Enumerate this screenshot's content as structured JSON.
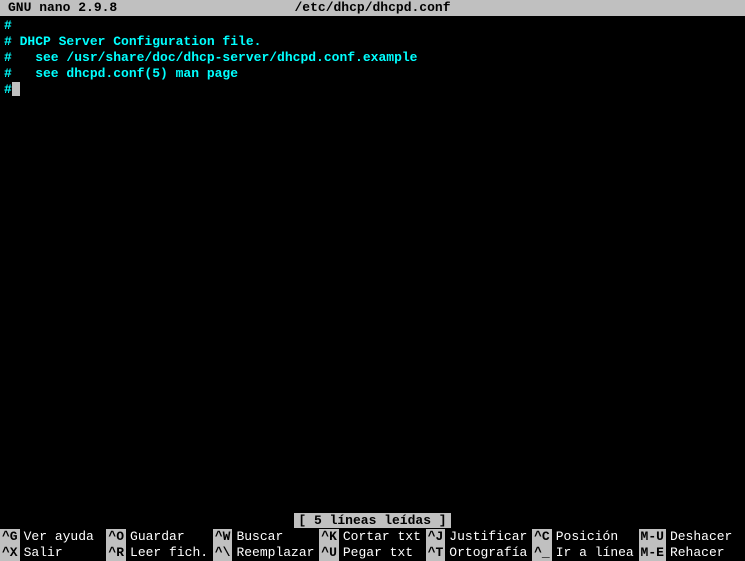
{
  "titlebar": {
    "app": "GNU nano 2.9.8",
    "filename": "/etc/dhcp/dhcpd.conf"
  },
  "content": {
    "lines": [
      "#",
      "# DHCP Server Configuration file.",
      "#   see /usr/share/doc/dhcp-server/dhcpd.conf.example",
      "#   see dhcpd.conf(5) man page",
      "#"
    ]
  },
  "status": {
    "message": "[ 5 líneas leídas ]"
  },
  "help": {
    "row1": [
      {
        "key": "^G",
        "label": "Ver ayuda"
      },
      {
        "key": "^O",
        "label": "Guardar"
      },
      {
        "key": "^W",
        "label": "Buscar"
      },
      {
        "key": "^K",
        "label": "Cortar txt"
      },
      {
        "key": "^J",
        "label": "Justificar"
      },
      {
        "key": "^C",
        "label": "Posición"
      },
      {
        "key": "M-U",
        "label": "Deshacer"
      }
    ],
    "row2": [
      {
        "key": "^X",
        "label": "Salir"
      },
      {
        "key": "^R",
        "label": "Leer fich."
      },
      {
        "key": "^\\",
        "label": "Reemplazar"
      },
      {
        "key": "^U",
        "label": "Pegar txt"
      },
      {
        "key": "^T",
        "label": "Ortografía"
      },
      {
        "key": "^_",
        "label": "Ir a línea"
      },
      {
        "key": "M-E",
        "label": "Rehacer"
      }
    ]
  }
}
